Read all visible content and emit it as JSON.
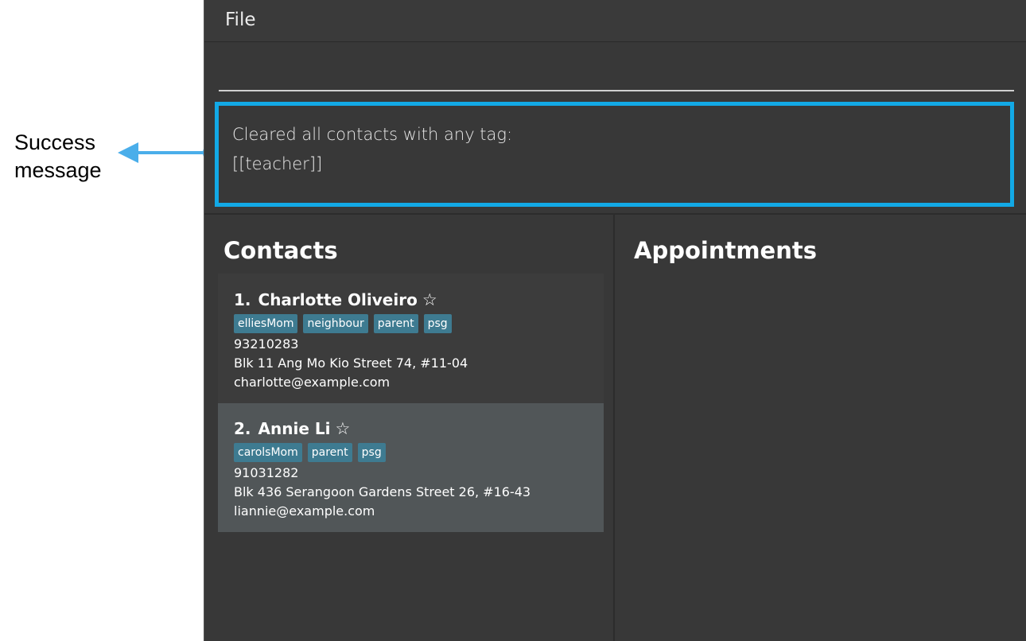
{
  "annotation": {
    "line1": "Success",
    "line2": "message",
    "arrow_color": "#4aaeea"
  },
  "menu": {
    "file_label": "File"
  },
  "command": {
    "value": "",
    "placeholder": ""
  },
  "result": {
    "line1": "Cleared all contacts with any tag:",
    "line2": "[[teacher]]",
    "highlight_color": "#12a9e6"
  },
  "contacts_panel": {
    "title": "Contacts",
    "items": [
      {
        "index": "1.",
        "name": "Charlotte Oliveiro",
        "star": "☆",
        "tags": [
          "elliesMom",
          "neighbour",
          "parent",
          "psg"
        ],
        "phone": "93210283",
        "address": "Blk 11 Ang Mo Kio Street 74, #11-04",
        "email": "charlotte@example.com"
      },
      {
        "index": "2.",
        "name": "Annie Li",
        "star": "☆",
        "tags": [
          "carolsMom",
          "parent",
          "psg"
        ],
        "phone": "91031282",
        "address": "Blk 436 Serangoon Gardens Street 26, #16-43",
        "email": "liannie@example.com"
      }
    ]
  },
  "appointments_panel": {
    "title": "Appointments"
  },
  "colors": {
    "window_bg": "#383838",
    "tag_bg": "#3e7b91",
    "card_odd": "#3c3c3c",
    "card_even": "#515658"
  }
}
